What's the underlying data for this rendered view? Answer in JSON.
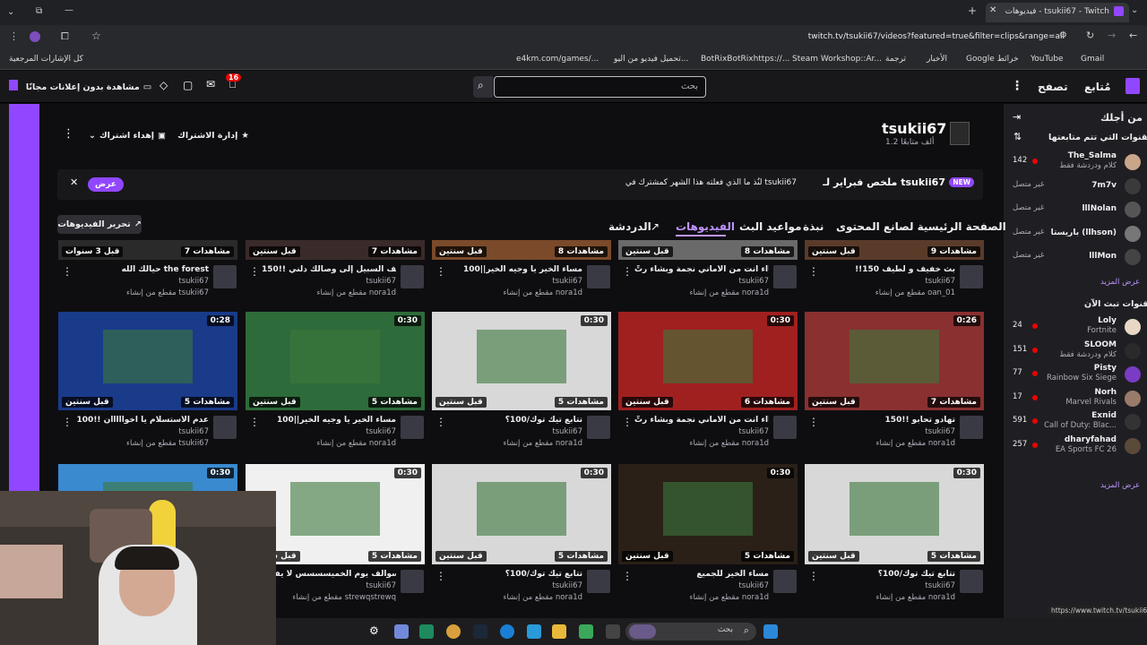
{
  "browser": {
    "tab_title": "فيديوهات - tsukii67 - Twitch",
    "url": "twitch.tv/tsukii67/videos?featured=true&filter=clips&range=all",
    "bookmarks": [
      "كل الإشارات المرجعية",
      "e4km.com/games/...",
      "تحميل فيديو من اليو...",
      "BotRixBotRixhttps://...",
      "Steam Workshop::Ar...",
      "ترجمة",
      "الأخبار",
      "Google خرائط",
      "YouTube",
      "Gmail"
    ],
    "status_url": "https://www.twitch.tv/tsukii67"
  },
  "topnav": {
    "follow": "مُتابع",
    "browse": "تصفح",
    "search_placeholder": "بحث",
    "ad_free": "مشاهدة بدون إعلانات مجانًا",
    "notif_count": "16"
  },
  "sidebar": {
    "for_you": "من أجلك",
    "followed_heading": "القنوات التي تتم متابعتها",
    "followed": [
      {
        "name": "The_Salma",
        "game": "كلام ودردشة فقط",
        "viewers": "142",
        "live": true,
        "color": "#c9a58a"
      },
      {
        "name": "7m7v",
        "game": "",
        "viewers": "غير متصل",
        "live": false,
        "color": "#3a3a3a"
      },
      {
        "name": "lllNolan",
        "game": "",
        "viewers": "غير متصل",
        "live": false,
        "color": "#555"
      },
      {
        "name": "باريستا (llhson)",
        "game": "",
        "viewers": "غير متصل",
        "live": false,
        "color": "#777"
      },
      {
        "name": "lllMon",
        "game": "",
        "viewers": "غير متصل",
        "live": false,
        "color": "#444"
      }
    ],
    "show_more_1": "عرض المزيد",
    "live_heading": "قنوات تبث الآن",
    "live": [
      {
        "name": "Loly",
        "game": "Fortnite",
        "viewers": "24",
        "color": "#e8d7c5"
      },
      {
        "name": "SLOOM",
        "game": "كلام ودردشة فقط",
        "viewers": "151",
        "color": "#2a2a2a"
      },
      {
        "name": "Pisty",
        "game": "Rainbow Six Siege",
        "viewers": "77",
        "color": "#7a3cc4"
      },
      {
        "name": "Norh",
        "game": "Marvel Rivals",
        "viewers": "17",
        "color": "#9a7a6a"
      },
      {
        "name": "Exnid",
        "game": "Call of Duty: Blac...",
        "viewers": "591",
        "color": "#333"
      },
      {
        "name": "dharyfahad",
        "game": "EA Sports FC 26",
        "viewers": "257",
        "color": "#5a4a3a"
      }
    ],
    "show_more_2": "عرض المزيد"
  },
  "channel": {
    "name": "tsukii67",
    "followers": "1.2 ألف متابعًا",
    "manage_sub": "إدارة الاشتراك",
    "gift_sub": "إهداء اشتراك",
    "recap_badge": "NEW",
    "recap_title": "ملخص فبراير لـ tsukii67",
    "recap_sub": "لنُذ ما الذي فعلته هذا الشهر كمشترك في tsukii67",
    "recap_button": "عرض",
    "tabs": [
      "الصفحة الرئيسية لصانع المحتوى",
      "نبذة",
      "مواعيد البث",
      "الفيديوهات",
      "الدردشة"
    ],
    "edit_videos": "تحرير الفيديوهات"
  },
  "videos": [
    [
      {
        "title": "!!150 بث خفيف و لطيف",
        "channel": "tsukii67",
        "clipper": "مقطع من إنشاء oan_01",
        "views": "9 مشاهدات",
        "age": "قبل سنتين",
        "duration": "",
        "bg": "#5a3b2a"
      },
      {
        "title": "وتشااء أنت من الأماني نجمة وبشاء رتِّ...",
        "channel": "tsukii67",
        "clipper": "مقطع من إنشاء nora1d",
        "views": "8 مشاهدات",
        "age": "قبل سنتين",
        "duration": "",
        "bg": "#6a6a6a"
      },
      {
        "title": "مساء الخير يا وجيه الخير||100",
        "channel": "tsukii67",
        "clipper": "مقطع من إنشاء nora1d",
        "views": "8 مشاهدات",
        "age": "قبل سنتين",
        "duration": "",
        "bg": "#7a4a2a"
      },
      {
        "title": "كيف السبيل إلى وصالك دلني !!150",
        "channel": "tsukii67",
        "clipper": "مقطع من إنشاء nora1d",
        "views": "7 مشاهدات",
        "age": "قبل سنتين",
        "duration": "",
        "bg": "#3a2a2a"
      },
      {
        "title": "حيالك الله the forest",
        "channel": "tsukii67",
        "clipper": "مقطع من إنشاء tsukii67",
        "views": "7 مشاهدات",
        "age": "قبل 3 سنوات",
        "duration": "",
        "bg": "#2a2a2a"
      }
    ],
    [
      {
        "title": "تهادو تحابو !!150",
        "channel": "tsukii67",
        "clipper": "مقطع من إنشاء nora1d",
        "views": "7 مشاهدات",
        "age": "قبل سنتين",
        "duration": "0:26",
        "bg": "#8a3030"
      },
      {
        "title": "وتشااء أنت من الأماني نجمة وبشاء رتِّ...",
        "channel": "tsukii67",
        "clipper": "مقطع من إنشاء nora1d",
        "views": "6 مشاهدات",
        "age": "قبل سنتين",
        "duration": "0:30",
        "bg": "#a02020"
      },
      {
        "title": "تتابع تيك توك/100؟",
        "channel": "tsukii67",
        "clipper": "مقطع من إنشاء nora1d",
        "views": "5 مشاهدات",
        "age": "قبل سنتين",
        "duration": "0:30",
        "bg": "#d8d8d8"
      },
      {
        "title": "مساء الخير يا وجيه الخير||100",
        "channel": "tsukii67",
        "clipper": "مقطع من إنشاء nora1d",
        "views": "5 مشاهدات",
        "age": "قبل سنتين",
        "duration": "0:30",
        "bg": "#2e6b3a"
      },
      {
        "title": "عدم الأستسلام يا اخوااااان !!100",
        "channel": "tsukii67",
        "clipper": "مقطع من إنشاء tsukii67",
        "views": "5 مشاهدات",
        "age": "قبل سنتين",
        "duration": "0:28",
        "bg": "#1a3a8a"
      }
    ],
    [
      {
        "title": "تتابع تيك توك/100؟",
        "channel": "tsukii67",
        "clipper": "مقطع من إنشاء nora1d",
        "views": "5 مشاهدات",
        "age": "قبل سنتين",
        "duration": "0:30",
        "bg": "#d8d8d8"
      },
      {
        "title": "مساء الخير للجميع",
        "channel": "tsukii67",
        "clipper": "مقطع من إنشاء nora1d",
        "views": "5 مشاهدات",
        "age": "قبل سنتين",
        "duration": "0:30",
        "bg": "#2a2018"
      },
      {
        "title": "تتابع تيك توك/100؟",
        "channel": "tsukii67",
        "clipper": "مقطع من إنشاء nora1d",
        "views": "5 مشاهدات",
        "age": "قبل سنتين",
        "duration": "0:30",
        "bg": "#d8d8d8"
      },
      {
        "title": "سوالف يوم الخميسسسس لا يفوتً",
        "channel": "tsukii67",
        "clipper": "مقطع من إنشاء strewqstrewq",
        "views": "5 مشاهدات",
        "age": "قبل سنتين",
        "duration": "0:30",
        "bg": "#f0f0f0"
      },
      {
        "title": "",
        "channel": "",
        "clipper": "",
        "views": "",
        "age": "",
        "duration": "0:30",
        "bg": "#3a8ad0"
      }
    ]
  ],
  "search_taskbar": "بحث"
}
